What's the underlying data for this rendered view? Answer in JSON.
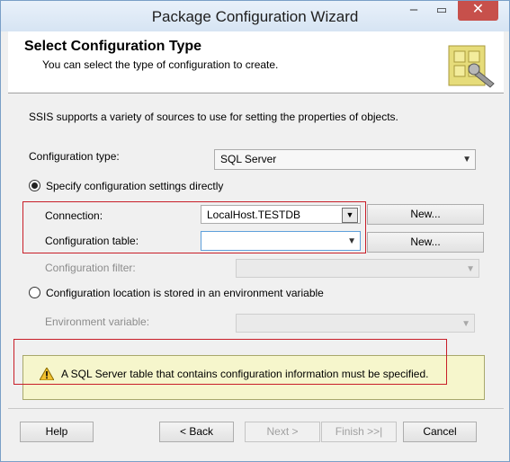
{
  "window": {
    "title": "Package Configuration Wizard",
    "minimize": "–",
    "maximize": "▭",
    "close": "✕"
  },
  "header": {
    "title": "Select Configuration Type",
    "subtitle": "You can select the type of configuration to create."
  },
  "intro": "SSIS supports a variety of sources to use for setting the properties of objects.",
  "configuration_type": {
    "label": "Configuration type:",
    "value": "SQL Server"
  },
  "option_direct": {
    "label": "Specify configuration settings directly",
    "selected": true
  },
  "connection": {
    "label": "Connection:",
    "value": "LocalHost.TESTDB",
    "button": "New..."
  },
  "config_table": {
    "label": "Configuration table:",
    "value": "",
    "button": "New..."
  },
  "config_filter": {
    "label": "Configuration filter:",
    "value": ""
  },
  "option_env": {
    "label": "Configuration location is stored in an environment variable",
    "selected": false
  },
  "env_variable": {
    "label": "Environment variable:",
    "value": ""
  },
  "message": "A SQL Server table that contains configuration information must be specified.",
  "footer": {
    "help": "Help",
    "back": "< Back",
    "next": "Next >",
    "finish": "Finish >>|",
    "cancel": "Cancel"
  },
  "colors": {
    "highlight_box": "#c81e28",
    "message_bg": "#f6f6cc",
    "close_button": "#c7504b"
  }
}
